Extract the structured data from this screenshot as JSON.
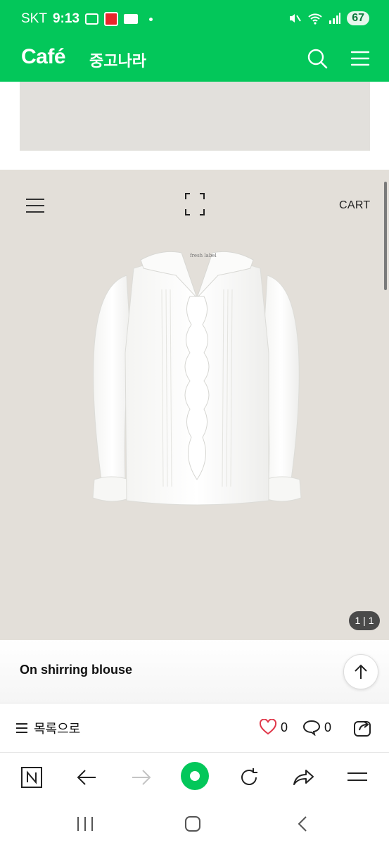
{
  "status_bar": {
    "carrier": "SKT",
    "time": "9:13",
    "battery": "67"
  },
  "header": {
    "logo": "Café",
    "cafe_name": "중고나라",
    "icons": [
      "search-icon",
      "menu-icon"
    ]
  },
  "product": {
    "cart_label": "CART",
    "image_counter": "1 | 1",
    "garment_tag": "fresh label",
    "title": "On shirring blouse"
  },
  "actions": {
    "list_label": "목록으로",
    "like_count": "0",
    "comment_count": "0"
  },
  "colors": {
    "brand": "#03c75a",
    "image_bg": "#e3dfd9",
    "like": "#e0394b"
  }
}
